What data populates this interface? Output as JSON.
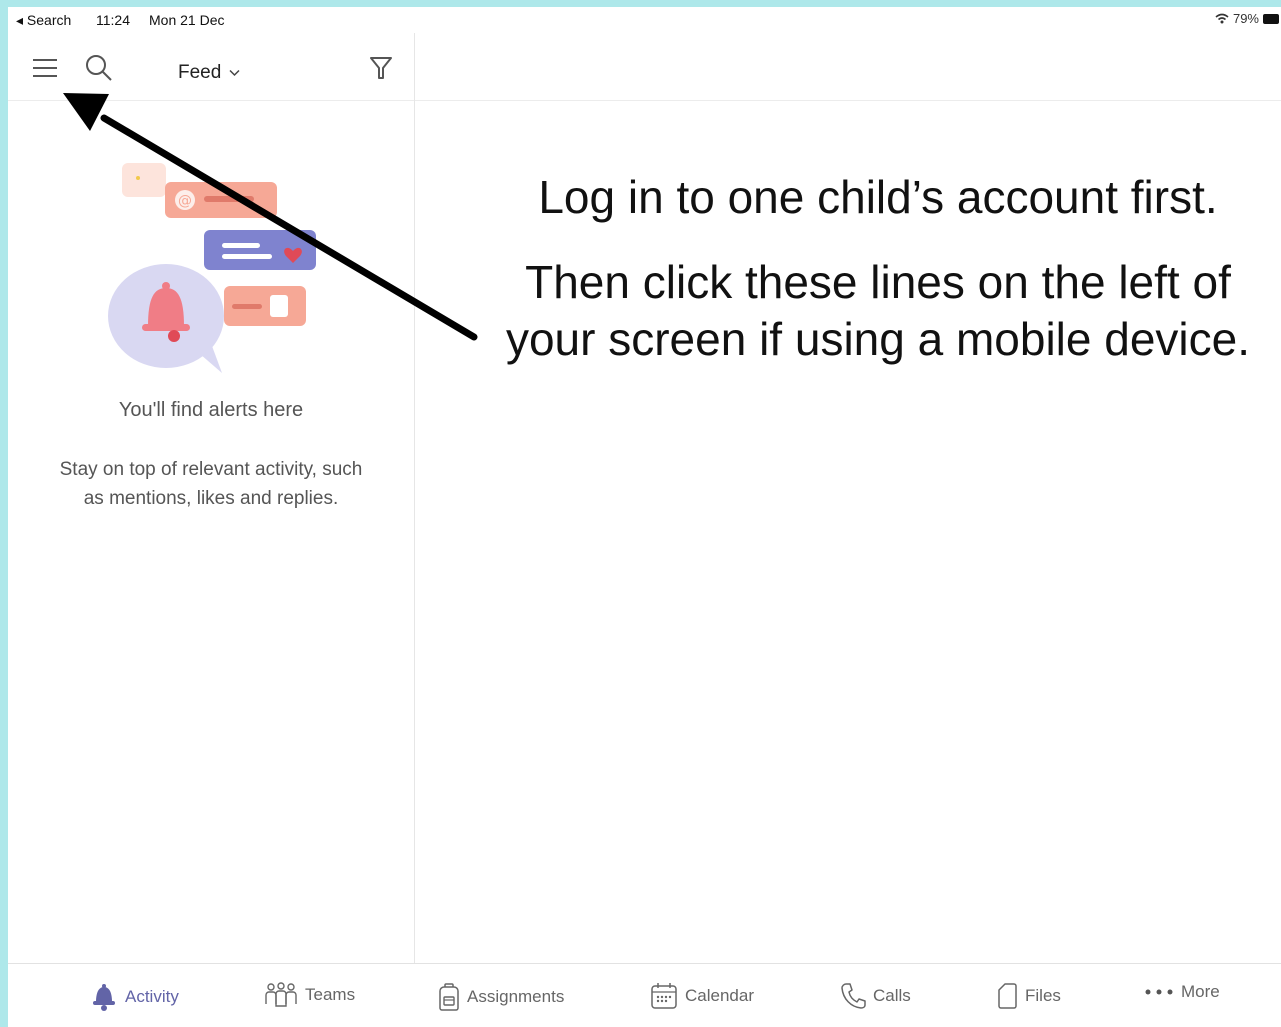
{
  "status_bar": {
    "back_label": "◂ Search",
    "time": "11:24",
    "date": "Mon 21 Dec",
    "battery": "79%"
  },
  "header": {
    "feed_label": "Feed"
  },
  "empty_state": {
    "title": "You'll find alerts here",
    "description": "Stay on top of relevant activity, such as mentions, likes and replies."
  },
  "annotation": {
    "line1": "Log in to one child’s account first.",
    "line2": "Then click these lines on the left of your screen if using a mobile device."
  },
  "tabs": [
    {
      "label": "Activity",
      "icon": "bell-icon",
      "active": true
    },
    {
      "label": "Teams",
      "icon": "teams-icon",
      "active": false
    },
    {
      "label": "Assignments",
      "icon": "assignments-icon",
      "active": false
    },
    {
      "label": "Calendar",
      "icon": "calendar-icon",
      "active": false
    },
    {
      "label": "Calls",
      "icon": "phone-icon",
      "active": false
    },
    {
      "label": "Files",
      "icon": "file-icon",
      "active": false
    },
    {
      "label": "More",
      "icon": "more-icon",
      "active": false
    }
  ],
  "colors": {
    "accent": "#6264a7",
    "background_border": "#aee8ea",
    "illustration_coral": "#f6a896",
    "illustration_lavender": "#d9d8f2",
    "illustration_heart": "#e04a57"
  }
}
